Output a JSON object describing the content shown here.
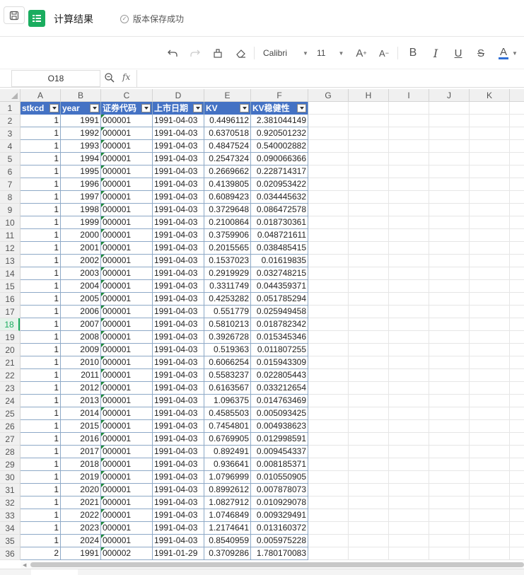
{
  "header": {
    "doc_title": "计算结果",
    "save_status": "版本保存成功"
  },
  "toolbar": {
    "font_name": "Calibri",
    "font_size": "11"
  },
  "formula_bar": {
    "cell_ref": "O18",
    "fx_label": "fx"
  },
  "grid": {
    "columns": [
      "A",
      "B",
      "C",
      "D",
      "E",
      "F",
      "G",
      "H",
      "I",
      "J",
      "K"
    ],
    "active_row": 18,
    "field_headers": [
      "stkcd",
      "year",
      "证券代码",
      "上市日期",
      "KV",
      "KV稳健性"
    ],
    "rows": [
      [
        "1",
        "1991",
        "000001",
        "1991-04-03",
        "0.4496112",
        "2.381044149"
      ],
      [
        "1",
        "1992",
        "000001",
        "1991-04-03",
        "0.6370518",
        "0.920501232"
      ],
      [
        "1",
        "1993",
        "000001",
        "1991-04-03",
        "0.4847524",
        "0.540002882"
      ],
      [
        "1",
        "1994",
        "000001",
        "1991-04-03",
        "0.2547324",
        "0.090066366"
      ],
      [
        "1",
        "1995",
        "000001",
        "1991-04-03",
        "0.2669662",
        "0.228714317"
      ],
      [
        "1",
        "1996",
        "000001",
        "1991-04-03",
        "0.4139805",
        "0.020953422"
      ],
      [
        "1",
        "1997",
        "000001",
        "1991-04-03",
        "0.6089423",
        "0.034445632"
      ],
      [
        "1",
        "1998",
        "000001",
        "1991-04-03",
        "0.3729648",
        "0.086472578"
      ],
      [
        "1",
        "1999",
        "000001",
        "1991-04-03",
        "0.2100864",
        "0.018730361"
      ],
      [
        "1",
        "2000",
        "000001",
        "1991-04-03",
        "0.3759906",
        "0.048721611"
      ],
      [
        "1",
        "2001",
        "000001",
        "1991-04-03",
        "0.2015565",
        "0.038485415"
      ],
      [
        "1",
        "2002",
        "000001",
        "1991-04-03",
        "0.1537023",
        "0.01619835"
      ],
      [
        "1",
        "2003",
        "000001",
        "1991-04-03",
        "0.2919929",
        "0.032748215"
      ],
      [
        "1",
        "2004",
        "000001",
        "1991-04-03",
        "0.3311749",
        "0.044359371"
      ],
      [
        "1",
        "2005",
        "000001",
        "1991-04-03",
        "0.4253282",
        "0.051785294"
      ],
      [
        "1",
        "2006",
        "000001",
        "1991-04-03",
        "0.551779",
        "0.025949458"
      ],
      [
        "1",
        "2007",
        "000001",
        "1991-04-03",
        "0.5810213",
        "0.018782342"
      ],
      [
        "1",
        "2008",
        "000001",
        "1991-04-03",
        "0.3926728",
        "0.015345346"
      ],
      [
        "1",
        "2009",
        "000001",
        "1991-04-03",
        "0.519363",
        "0.011807255"
      ],
      [
        "1",
        "2010",
        "000001",
        "1991-04-03",
        "0.6066254",
        "0.015943309"
      ],
      [
        "1",
        "2011",
        "000001",
        "1991-04-03",
        "0.5583237",
        "0.022805443"
      ],
      [
        "1",
        "2012",
        "000001",
        "1991-04-03",
        "0.6163567",
        "0.033212654"
      ],
      [
        "1",
        "2013",
        "000001",
        "1991-04-03",
        "1.096375",
        "0.014763469"
      ],
      [
        "1",
        "2014",
        "000001",
        "1991-04-03",
        "0.4585503",
        "0.005093425"
      ],
      [
        "1",
        "2015",
        "000001",
        "1991-04-03",
        "0.7454801",
        "0.004938623"
      ],
      [
        "1",
        "2016",
        "000001",
        "1991-04-03",
        "0.6769905",
        "0.012998591"
      ],
      [
        "1",
        "2017",
        "000001",
        "1991-04-03",
        "0.892491",
        "0.009454337"
      ],
      [
        "1",
        "2018",
        "000001",
        "1991-04-03",
        "0.936641",
        "0.008185371"
      ],
      [
        "1",
        "2019",
        "000001",
        "1991-04-03",
        "1.0796999",
        "0.010550905"
      ],
      [
        "1",
        "2020",
        "000001",
        "1991-04-03",
        "0.8992612",
        "0.007878073"
      ],
      [
        "1",
        "2021",
        "000001",
        "1991-04-03",
        "1.0827912",
        "0.010929078"
      ],
      [
        "1",
        "2022",
        "000001",
        "1991-04-03",
        "1.0746849",
        "0.009329491"
      ],
      [
        "1",
        "2023",
        "000001",
        "1991-04-03",
        "1.2174641",
        "0.013160372"
      ],
      [
        "1",
        "2024",
        "000001",
        "1991-04-03",
        "0.8540959",
        "0.005975228"
      ],
      [
        "2",
        "1991",
        "000002",
        "1991-01-29",
        "0.3709286",
        "1.780170083"
      ]
    ],
    "colors": {
      "header_fill": "#4472c4",
      "text_flag": "#1e8a3a",
      "active_row": "#1aad5f"
    }
  }
}
